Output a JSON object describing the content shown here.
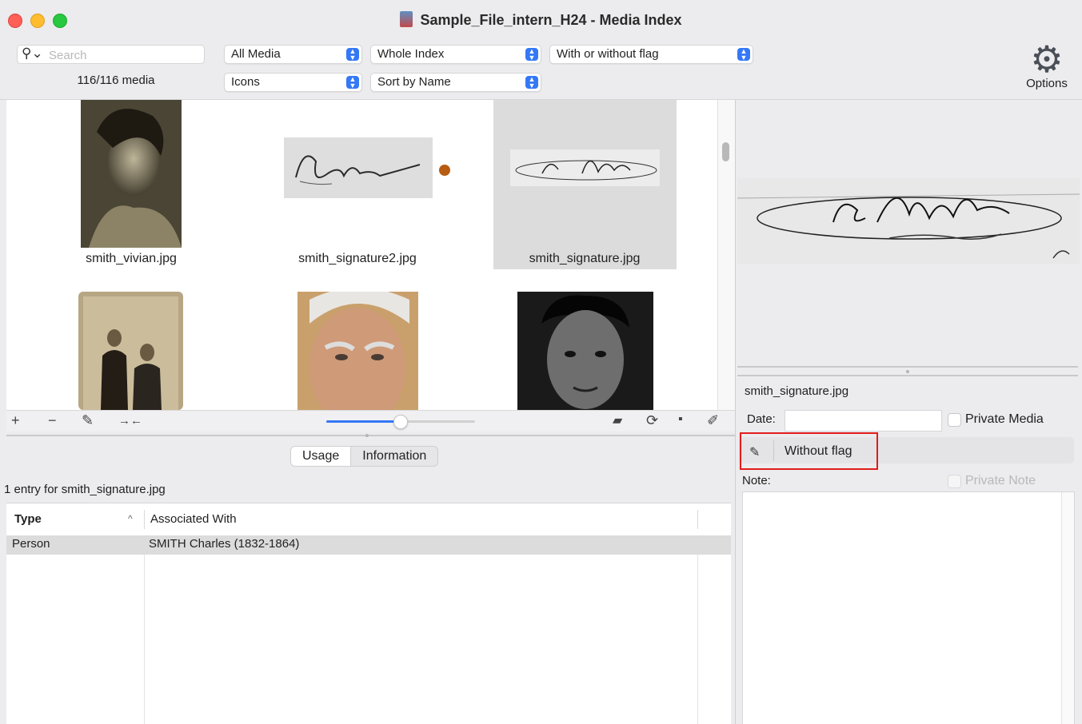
{
  "window": {
    "title": "Sample_File_intern_H24 - Media Index"
  },
  "toolbar": {
    "search_placeholder": "Search",
    "media_count": "116/116 media",
    "filter_media": "All Media",
    "filter_index": "Whole Index",
    "filter_flag": "With or without flag",
    "view_mode": "Icons",
    "sort_by": "Sort by Name",
    "options_label": "Options"
  },
  "grid": {
    "items": [
      {
        "name": "smith_vivian.jpg",
        "kind": "portrait-woman"
      },
      {
        "name": "smith_signature2.jpg",
        "kind": "signature",
        "flag_color": "#b85c11"
      },
      {
        "name": "smith_signature.jpg",
        "kind": "signature",
        "selected": true
      },
      {
        "name": "",
        "kind": "couple-photo"
      },
      {
        "name": "",
        "kind": "portrait-old-man"
      },
      {
        "name": "",
        "kind": "portrait-young-man"
      }
    ],
    "zoom_slider": 0.5
  },
  "usage": {
    "tabs": [
      "Usage",
      "Information"
    ],
    "active_tab": "Usage",
    "entry_text": "1 entry for smith_signature.jpg",
    "columns": [
      "Type",
      "Associated With"
    ],
    "rows": [
      {
        "type": "Person",
        "associated": "SMITH Charles (1832-1864)"
      }
    ]
  },
  "detail": {
    "filename": "smith_signature.jpg",
    "date_label": "Date:",
    "date_value": "",
    "private_media_label": "Private Media",
    "flag_label": "Without flag",
    "note_label": "Note:",
    "private_note_label": "Private Note"
  },
  "colors": {
    "accent": "#3478f6",
    "flag_highlight": "#e11c1c"
  }
}
